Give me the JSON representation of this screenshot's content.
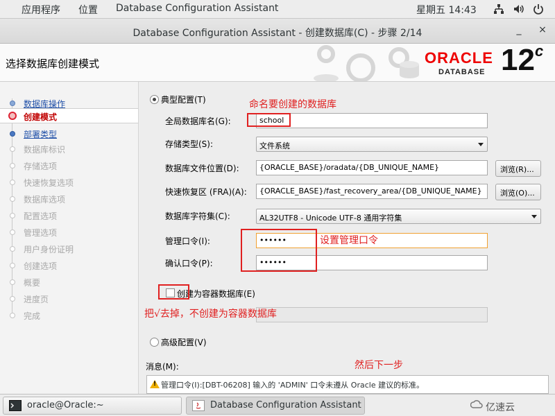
{
  "topbar": {
    "applications": "应用程序",
    "places": "位置",
    "app_name": "Database Configuration Assistant",
    "clock": "星期五 14:43",
    "icons": [
      "network-icon",
      "volume-icon",
      "power-icon"
    ]
  },
  "window": {
    "title": "Database Configuration Assistant - 创建数据库(C) - 步骤 2/14",
    "minimize": "_",
    "close": "×"
  },
  "header": {
    "step_title": "选择数据库创建模式",
    "brand": "ORACLE",
    "brand_sub": "DATABASE",
    "version": "12",
    "version_suffix": "c"
  },
  "nav": {
    "items": [
      {
        "label": "数据库操作",
        "state": "done"
      },
      {
        "label": "创建模式",
        "state": "current"
      },
      {
        "label": "部署类型",
        "state": "link"
      },
      {
        "label": "数据库标识",
        "state": "pending"
      },
      {
        "label": "存储选项",
        "state": "pending"
      },
      {
        "label": "快速恢复选项",
        "state": "pending"
      },
      {
        "label": "数据库选项",
        "state": "pending"
      },
      {
        "label": "配置选项",
        "state": "pending"
      },
      {
        "label": "管理选项",
        "state": "pending"
      },
      {
        "label": "用户身份证明",
        "state": "pending"
      },
      {
        "label": "创建选项",
        "state": "pending"
      },
      {
        "label": "概要",
        "state": "pending"
      },
      {
        "label": "进度页",
        "state": "pending"
      },
      {
        "label": "完成",
        "state": "pending"
      }
    ]
  },
  "form": {
    "typical_label": "典型配置(T)",
    "global_db_name_label": "全局数据库名(G):",
    "global_db_name_value": "school",
    "storage_type_label": "存储类型(S):",
    "storage_type_value": "文件系统",
    "db_file_location_label": "数据库文件位置(D):",
    "db_file_location_value": "{ORACLE_BASE}/oradata/{DB_UNIQUE_NAME}",
    "browse1": "浏览(R)...",
    "fra_label": "快速恢复区 (FRA)(A):",
    "fra_value": "{ORACLE_BASE}/fast_recovery_area/{DB_UNIQUE_NAME}",
    "browse2": "浏览(O)...",
    "charset_label": "数据库字符集(C):",
    "charset_value": "AL32UTF8 - Unicode UTF-8 通用字符集",
    "admin_pwd_label": "管理口令(I):",
    "admin_pwd_value": "••••••",
    "confirm_pwd_label": "确认口令(P):",
    "confirm_pwd_value": "••••••",
    "container_label": "创建为容器数据库(E)",
    "advanced_label": "高级配置(V)",
    "message_label": "消息(M):",
    "message_text": "管理口令(I):[DBT-06208] 输入的 'ADMIN' 口令未遵从 Oracle 建议的标准。"
  },
  "annotations": {
    "name_db": "命名要创建的数据库",
    "set_pwd": "设置管理口令",
    "uncheck": "把√去掉，不创建为容器数据库",
    "next": "然后下一步"
  },
  "taskbar": {
    "terminal": "oracle@Oracle:~",
    "dbca": "Database Configuration Assistant - ...",
    "watermark": "亿速云"
  },
  "colors": {
    "annotation_red": "#e02020",
    "oracle_red": "#ee0000",
    "nav_current": "#c00000",
    "nav_link": "#2050a8"
  }
}
